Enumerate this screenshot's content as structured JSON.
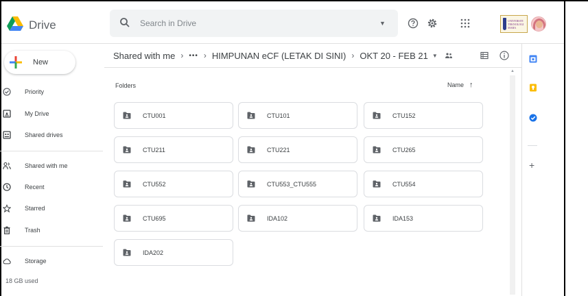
{
  "app": {
    "name": "Drive"
  },
  "search": {
    "placeholder": "Search in Drive"
  },
  "header": {
    "icons": [
      "search-icon",
      "search-options-icon",
      "help-icon",
      "settings-icon",
      "apps-icon"
    ],
    "org_logo_text": "UNIVERSITI TEKNOLOGI MARA"
  },
  "sidebar": {
    "new_label": "New",
    "items": [
      {
        "label": "Priority",
        "icon": "check-circle-icon"
      },
      {
        "label": "My Drive",
        "icon": "my-drive-icon"
      },
      {
        "label": "Shared drives",
        "icon": "shared-drives-icon"
      },
      {
        "label": "Shared with me",
        "icon": "people-icon"
      },
      {
        "label": "Recent",
        "icon": "clock-icon"
      },
      {
        "label": "Starred",
        "icon": "star-icon"
      },
      {
        "label": "Trash",
        "icon": "trash-icon"
      },
      {
        "label": "Storage",
        "icon": "cloud-icon"
      }
    ],
    "storage_used": "18 GB used"
  },
  "breadcrumb": {
    "root": "Shared with me",
    "ellipsis": "•••",
    "parent": "HIMPUNAN eCF (LETAK DI SINI)",
    "current": "OKT 20 - FEB 21"
  },
  "main": {
    "folders_heading": "Folders",
    "sort_label": "Name",
    "sort_direction": "ascending",
    "folders": [
      "CTU001",
      "CTU101",
      "CTU152",
      "CTU211",
      "CTU221",
      "CTU265",
      "CTU552",
      "CTU553_CTU555",
      "CTU554",
      "CTU695",
      "IDA102",
      "IDA153",
      "IDA202"
    ]
  },
  "colors": {
    "accent_blue": "#1a73e8",
    "folder_icon": "#5f6368",
    "keep_yellow": "#fbbc04",
    "tasks_blue": "#1a73e8"
  }
}
